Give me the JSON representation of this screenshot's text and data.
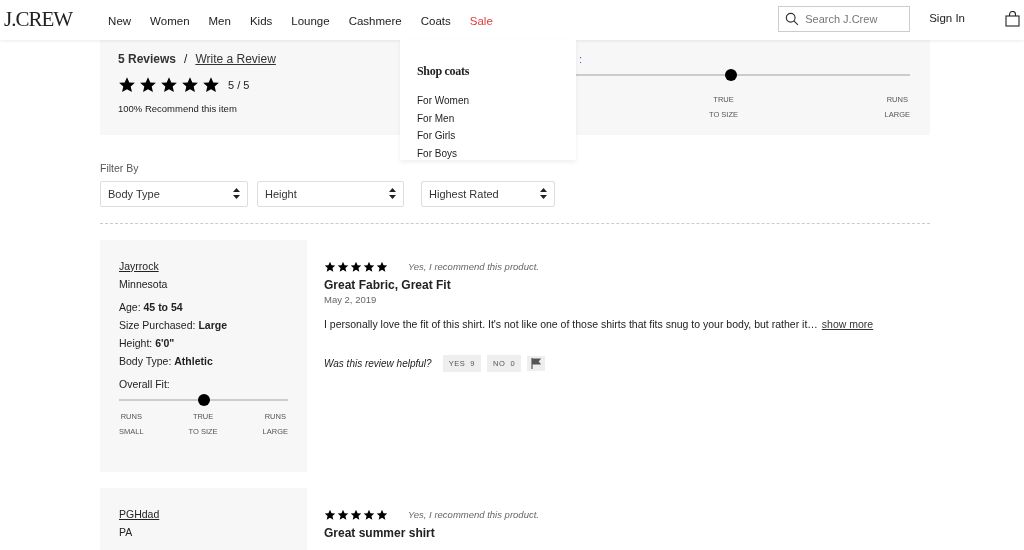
{
  "header": {
    "logo": "J.CREW",
    "nav": [
      {
        "label": "New",
        "selected": false,
        "kind": "link"
      },
      {
        "label": "Women",
        "selected": false,
        "kind": "link"
      },
      {
        "label": "Men",
        "selected": false,
        "kind": "link"
      },
      {
        "label": "Kids",
        "selected": false,
        "kind": "link"
      },
      {
        "label": "Lounge",
        "selected": false,
        "kind": "link"
      },
      {
        "label": "Cashmere",
        "selected": false,
        "kind": "link"
      },
      {
        "label": "Coats",
        "selected": true,
        "kind": "link"
      },
      {
        "label": "Sale",
        "selected": false,
        "kind": "sale"
      }
    ],
    "search": {
      "placeholder": "Search J.Crew"
    },
    "sign_in": "Sign In"
  },
  "menu": {
    "title": "Shop coats",
    "items": [
      "For Women",
      "For Men",
      "For Girls",
      "For Boys"
    ]
  },
  "summary": {
    "count": "5 Reviews",
    "separator": "/",
    "write_link": "Write a Review",
    "stars": 5,
    "score": "5 / 5",
    "recommend": "100% Recommend this item",
    "fit": {
      "label_fragment": ":",
      "level": 0.5,
      "labels": [
        {
          "line1": "TRUE",
          "line2": "TO SIZE"
        },
        {
          "line1": "RUNS",
          "line2": "LARGE"
        }
      ]
    }
  },
  "filters": {
    "label": "Filter By",
    "selects": [
      "Body Type",
      "Height",
      "Highest Rated"
    ]
  },
  "reviews": [
    {
      "user": "Jayrrock",
      "location": "Minnesota",
      "details": [
        {
          "label": "Age:",
          "value": "45 to 54"
        },
        {
          "label": "Size Purchased:",
          "value": "Large"
        },
        {
          "label": "Height:",
          "value": "6'0\""
        },
        {
          "label": "Body Type:",
          "value": "Athletic"
        }
      ],
      "fit": {
        "label": "Overall Fit:",
        "level": 0.5,
        "labels": [
          {
            "line1": "RUNS",
            "line2": "SMALL"
          },
          {
            "line1": "TRUE",
            "line2": "TO SIZE"
          },
          {
            "line1": "RUNS",
            "line2": "LARGE"
          }
        ]
      },
      "stars": 5,
      "recommend": "Yes, I recommend this product.",
      "title": "Great Fabric, Great Fit",
      "date": "May 2, 2019",
      "text": "I personally love the fit of this shirt. It's not like one of those shirts that fits snug to your body, but rather it…",
      "more": "show more",
      "helpful": {
        "question": "Was this review helpful?",
        "yes": "YES",
        "yes_count": "9",
        "no": "NO",
        "no_count": "0"
      }
    },
    {
      "user": "PGHdad",
      "location": "PA",
      "stars": 5,
      "recommend": "Yes, I recommend this product.",
      "title": "Great summer shirt"
    }
  ]
}
